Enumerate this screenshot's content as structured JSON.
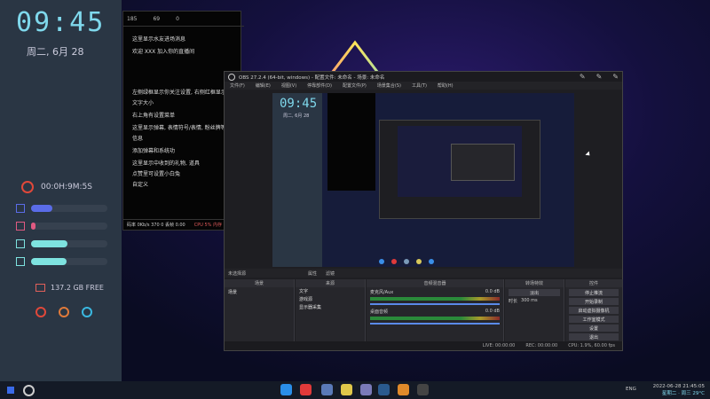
{
  "widgets": {
    "clock": "09:45",
    "date": "周二, 6月 28",
    "timer": "00:0H:9M:5S",
    "disk": "137.2 GB FREE",
    "bars": [
      {
        "icon": "square-icon",
        "color": "#5a6ce8",
        "fraction": 0.28
      },
      {
        "icon": "circle-icon",
        "color": "#e05a82",
        "fraction": 0.06
      },
      {
        "icon": "heart-icon",
        "color": "#7ee3e0",
        "fraction": 0.48
      },
      {
        "icon": "headphone-icon",
        "color": "#7ee3e0",
        "fraction": 0.46
      }
    ]
  },
  "notes": {
    "header": [
      "185",
      "69",
      "0"
    ],
    "lines": [
      "这里显示水友进场消息",
      "欢迎 XXX 加入你的直播间",
      "左侧绿框显示你关注设置, 右侧红框显示修改",
      "文字大小",
      "右上角有设置菜单",
      "这里显示弹幕, 表情符号/表情, 粉丝牌等",
      "信息",
      "添加弹幕和系统功",
      "这里显示中收到的礼物, 道具",
      "点赞里可设置小白兔",
      "自定义"
    ],
    "status": [
      "码率 0Kb/s 370 0 丢帧 0.00",
      "CPU 5%  内存 1%"
    ]
  },
  "obs": {
    "title": "OBS 27.2.4 (64-bit, windows) - 配置文件: 未命名 - 场景: 未命名",
    "menu": [
      "文件(F)",
      "编辑(E)",
      "视图(V)",
      "停靠部件(D)",
      "配置文件(P)",
      "场景集合(S)",
      "工具(T)",
      "帮助(H)"
    ],
    "preview_clock": "09:45",
    "preview_date": "周二, 6月 28",
    "docks": {
      "scenes": {
        "header": "场景",
        "items": [
          "场景"
        ]
      },
      "sources": {
        "header": "来源",
        "items": [
          "文字",
          "游戏源",
          "显示器采集"
        ]
      },
      "mixer": {
        "header": "音频混音器",
        "channels": [
          {
            "name": "麦克风/Aux",
            "level": "0.0 dB"
          },
          {
            "name": "桌面音频",
            "level": "0.0 dB"
          }
        ]
      },
      "transitions": {
        "header": "转场特效",
        "type": "淡出",
        "duration_label": "时长",
        "duration": "300 ms"
      },
      "controls": {
        "header": "控件",
        "buttons": [
          "停止推流",
          "开始录制",
          "启动虚拟摄像机",
          "工作室模式",
          "设置",
          "退出"
        ]
      }
    },
    "toolbar_labels": [
      "未选择源",
      "属性",
      "滤镜"
    ],
    "status": [
      "LIVE: 00:00:00",
      "REC: 00:00:00",
      "CPU: 1.9%, 60.00 fps"
    ]
  },
  "taskbar": {
    "tray_time": "2022-06-28 21:45:05",
    "tray_sub": "星期二 · 周三 29°C",
    "lang": "ENG"
  },
  "colors": {
    "accent": "#7fd8ec",
    "panel": "#2a3644",
    "obs_bg": "#1e1e22"
  }
}
